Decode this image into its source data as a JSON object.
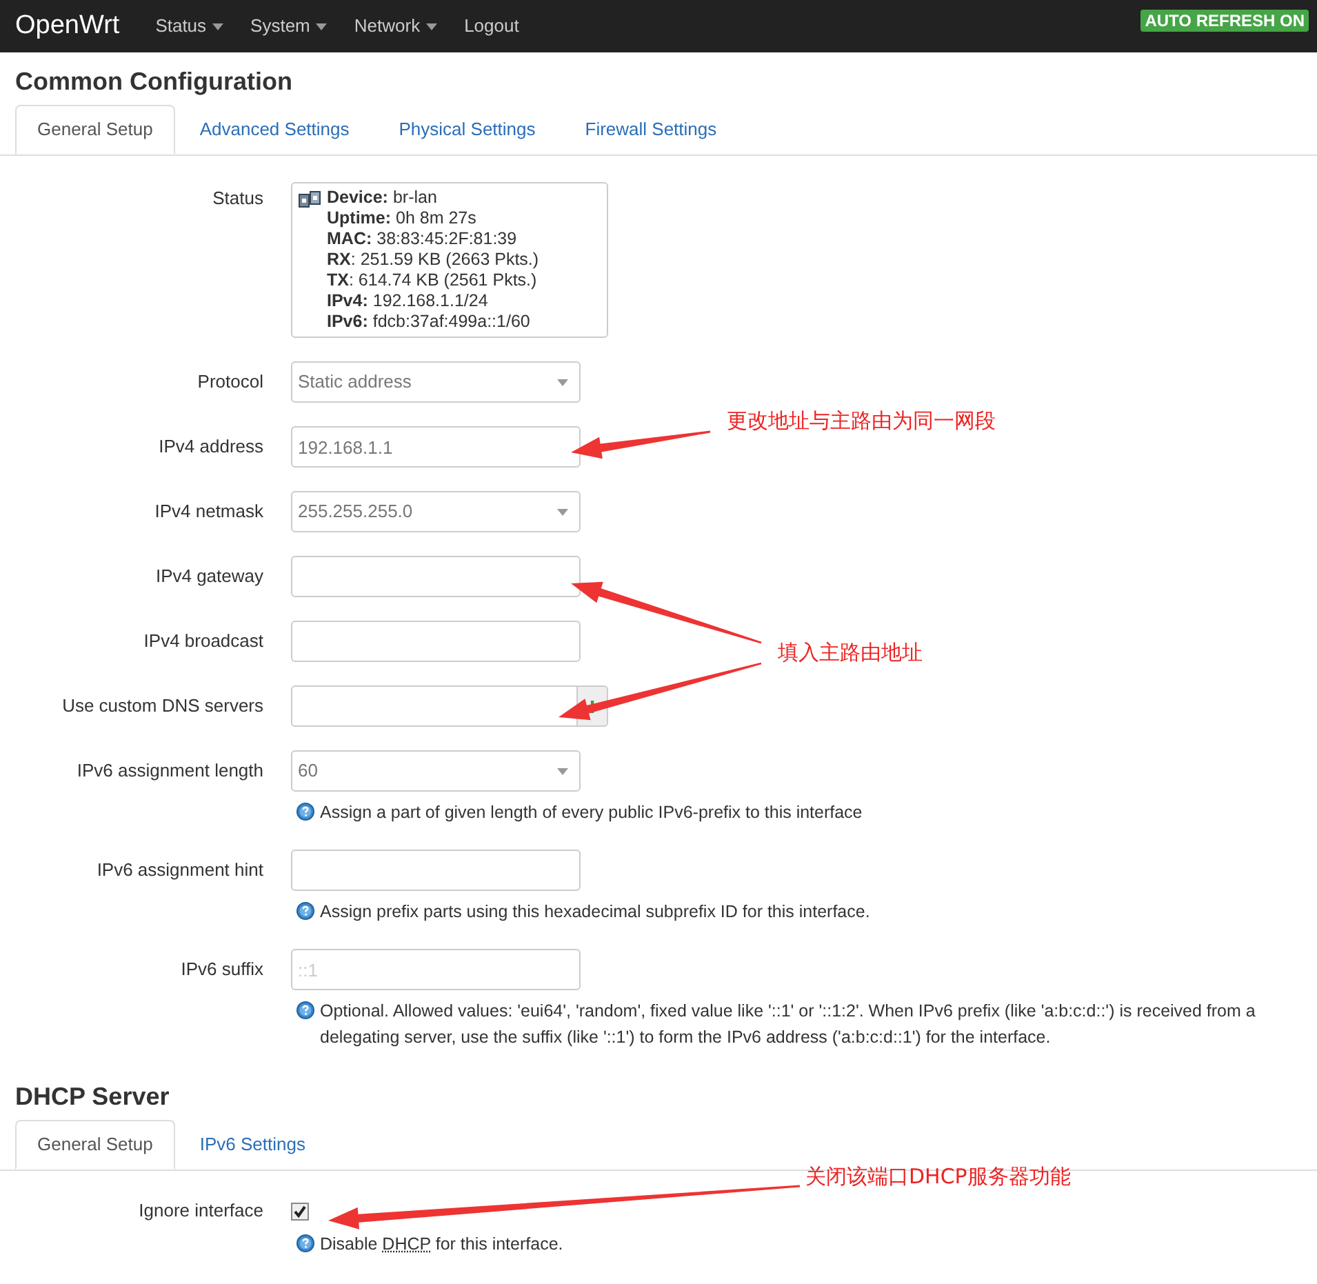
{
  "navbar": {
    "brand": "OpenWrt",
    "menu": [
      {
        "label": "Status",
        "dropdown": true
      },
      {
        "label": "System",
        "dropdown": true
      },
      {
        "label": "Network",
        "dropdown": true
      },
      {
        "label": "Logout",
        "dropdown": false
      }
    ],
    "badge": "AUTO REFRESH ON"
  },
  "common": {
    "title": "Common Configuration",
    "tabs": [
      {
        "label": "General Setup",
        "selected": true
      },
      {
        "label": "Advanced Settings",
        "selected": false
      },
      {
        "label": "Physical Settings",
        "selected": false
      },
      {
        "label": "Firewall Settings",
        "selected": false
      }
    ],
    "status": {
      "label": "Status",
      "lines": [
        "**Device:** br-lan",
        "**Uptime:** 0h 8m 27s",
        "**MAC:** 38:83:45:2F:81:39",
        "**RX**: 251.59 KB (2663 Pkts.)",
        "**TX**: 614.74 KB (2561 Pkts.)",
        "**IPv4:** 192.168.1.1/24",
        "**IPv6:** fdcb:37af:499a::1/60"
      ]
    },
    "fields": [
      {
        "label": "Protocol",
        "kind": "select",
        "value": "Static address"
      },
      {
        "label": "IPv4 address",
        "kind": "text",
        "value": "192.168.1.1"
      },
      {
        "label": "IPv4 netmask",
        "kind": "select",
        "value": "255.255.255.0"
      },
      {
        "label": "IPv4 gateway",
        "kind": "text"
      },
      {
        "label": "IPv4 broadcast",
        "kind": "text"
      },
      {
        "label": "Use custom DNS servers",
        "kind": "dynlist"
      },
      {
        "label": "IPv6 assignment length",
        "kind": "select",
        "value": "60",
        "help": "Assign a part of given length of every public IPv6-prefix to this interface"
      },
      {
        "label": "IPv6 assignment hint",
        "kind": "text",
        "help": "Assign prefix parts using this hexadecimal subprefix ID for this interface."
      },
      {
        "label": "IPv6 suffix",
        "kind": "text",
        "placeholder": "::1",
        "help": "Optional. Allowed values: 'eui64', 'random', fixed value like '::1' or '::1:2'. When IPv6 prefix (like 'a:b:c:d::') is received from a delegating server, use the suffix (like '::1') to form the IPv6 address ('a:b:c:d::1') for the interface."
      }
    ]
  },
  "dhcp": {
    "title": "DHCP Server",
    "tabs": [
      {
        "label": "General Setup",
        "selected": true
      },
      {
        "label": "IPv6 Settings",
        "selected": false
      }
    ],
    "ignore": {
      "label": "Ignore interface",
      "checked": true,
      "help_before": "Disable ",
      "help_abbr": "DHCP",
      "help_after": " for this interface."
    }
  },
  "annotations": [
    "更改地址与主路由为同一网段",
    "填入主路由地址",
    "关闭该端口DHCP服务器功能"
  ]
}
